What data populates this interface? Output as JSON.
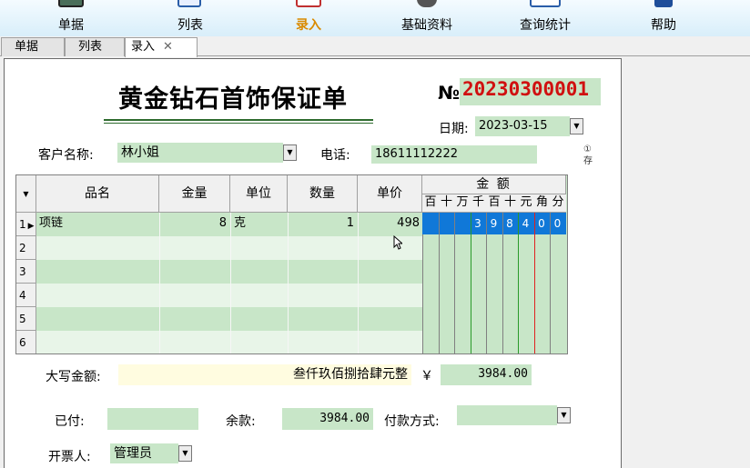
{
  "toolbar": {
    "items": [
      {
        "label": "单据",
        "icon": "document-icon",
        "color": "#2a2a2a"
      },
      {
        "label": "列表",
        "icon": "list-icon",
        "color": "#2a2a2a"
      },
      {
        "label": "录入",
        "icon": "entry-icon",
        "color": "#d98a00"
      },
      {
        "label": "基础资料",
        "icon": "database-icon",
        "color": "#2a2a2a"
      },
      {
        "label": "查询统计",
        "icon": "chart-icon",
        "color": "#2a2a2a"
      },
      {
        "label": "帮助",
        "icon": "book-icon",
        "color": "#2a2a2a"
      }
    ]
  },
  "tabs": {
    "items": [
      "单据",
      "列表",
      "录入"
    ],
    "close": "✕"
  },
  "form": {
    "title": "黄金钻石首饰保证单",
    "no_mark": "№",
    "no_value": "20230300001",
    "date_label": "日期:",
    "date_value": "2023-03-15",
    "customer_label": "客户名称:",
    "customer_value": "林小姐",
    "phone_label": "电话:",
    "phone_value": "18611112222",
    "side_note": "①\n存",
    "grid": {
      "headers": [
        "品名",
        "金量",
        "单位",
        "数量",
        "单价"
      ],
      "amount_header": "金  额",
      "amount_digits": [
        "百",
        "十",
        "万",
        "千",
        "百",
        "十",
        "元",
        "角",
        "分"
      ],
      "row_numbers": [
        "1",
        "2",
        "3",
        "4",
        "5",
        "6"
      ],
      "rows": [
        {
          "name": "项链",
          "weight": "8",
          "unit": "克",
          "qty": "1",
          "price": "498",
          "digits": [
            "",
            "",
            "",
            "3",
            "9",
            "8",
            "4",
            "0",
            "0"
          ]
        }
      ]
    },
    "capital_label": "大写金额:",
    "capital_value": "叁仟玖佰捌拾肆元整",
    "yen": "￥",
    "total_value": "3984.00",
    "paid_label": "已付:",
    "paid_value": "",
    "balance_label": "余款:",
    "balance_value": "3984.00",
    "paymethod_label": "付款方式:",
    "paymethod_value": "",
    "issuer_label": "开票人:",
    "issuer_value": "管理员"
  }
}
